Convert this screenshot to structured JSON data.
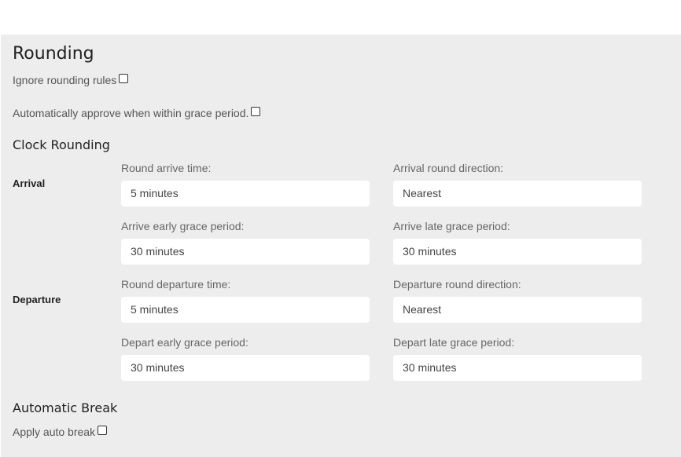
{
  "rounding": {
    "title": "Rounding",
    "ignore_rounding_label": "Ignore rounding rules",
    "ignore_rounding_checked": false,
    "auto_approve_label": "Automatically approve when within grace period.",
    "auto_approve_checked": false
  },
  "clock_rounding": {
    "title": "Clock Rounding",
    "arrival": {
      "label": "Arrival",
      "round_time": {
        "label": "Round arrive time:",
        "value": "5 minutes"
      },
      "round_direction": {
        "label": "Arrival round direction:",
        "value": "Nearest"
      },
      "early_grace": {
        "label": "Arrive early grace period:",
        "value": "30 minutes"
      },
      "late_grace": {
        "label": "Arrive late grace period:",
        "value": "30 minutes"
      }
    },
    "departure": {
      "label": "Departure",
      "round_time": {
        "label": "Round departure time:",
        "value": "5 minutes"
      },
      "round_direction": {
        "label": "Departure round direction:",
        "value": "Nearest"
      },
      "early_grace": {
        "label": "Depart early grace period:",
        "value": "30 minutes"
      },
      "late_grace": {
        "label": "Depart late grace period:",
        "value": "30 minutes"
      }
    }
  },
  "automatic_break": {
    "title": "Automatic Break",
    "apply_label": "Apply auto break",
    "apply_checked": false
  }
}
